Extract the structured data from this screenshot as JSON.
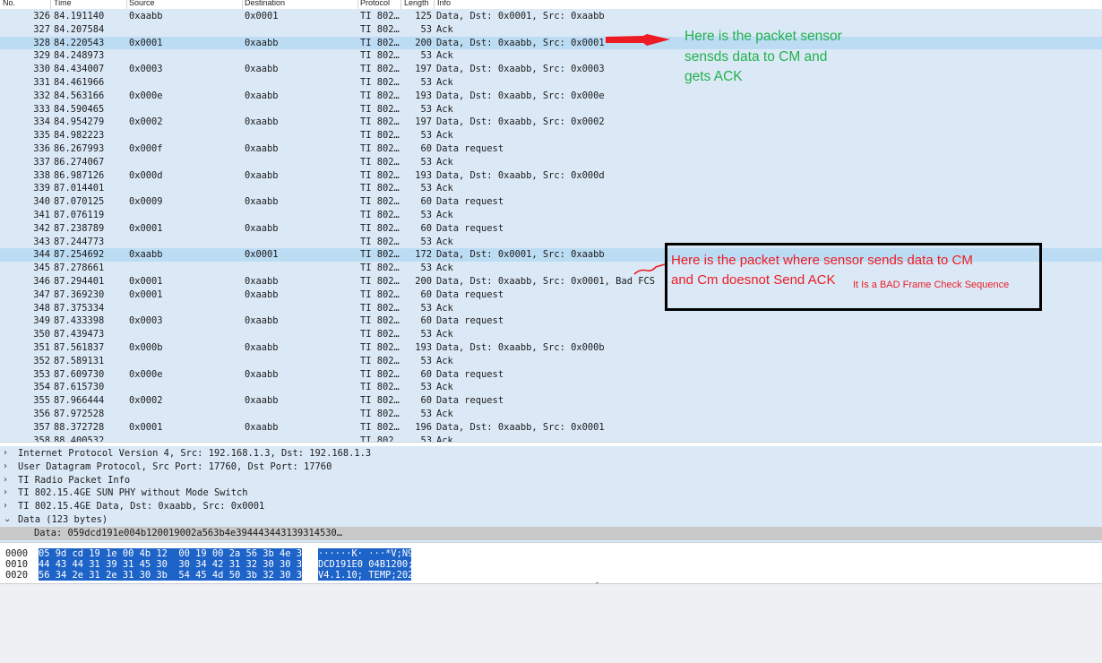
{
  "columns": {
    "no": "No.",
    "time": "Time",
    "source": "Source",
    "destination": "Destination",
    "protocol": "Protocol",
    "length": "Length",
    "info": "Info"
  },
  "packets": [
    {
      "no": "326",
      "time": "84.191140",
      "src": "0xaabb",
      "dst": "0x0001",
      "proto": "TI 802…",
      "len": "125",
      "info": "Data, Dst: 0x0001, Src: 0xaabb"
    },
    {
      "no": "327",
      "time": "84.207584",
      "src": "",
      "dst": "",
      "proto": "TI 802…",
      "len": "53",
      "info": "Ack"
    },
    {
      "no": "328",
      "time": "84.220543",
      "src": "0x0001",
      "dst": "0xaabb",
      "proto": "TI 802…",
      "len": "200",
      "info": "Data, Dst: 0xaabb, Src: 0x0001",
      "selected": true
    },
    {
      "no": "329",
      "time": "84.248973",
      "src": "",
      "dst": "",
      "proto": "TI 802…",
      "len": "53",
      "info": "Ack"
    },
    {
      "no": "330",
      "time": "84.434007",
      "src": "0x0003",
      "dst": "0xaabb",
      "proto": "TI 802…",
      "len": "197",
      "info": "Data, Dst: 0xaabb, Src: 0x0003"
    },
    {
      "no": "331",
      "time": "84.461966",
      "src": "",
      "dst": "",
      "proto": "TI 802…",
      "len": "53",
      "info": "Ack"
    },
    {
      "no": "332",
      "time": "84.563166",
      "src": "0x000e",
      "dst": "0xaabb",
      "proto": "TI 802…",
      "len": "193",
      "info": "Data, Dst: 0xaabb, Src: 0x000e"
    },
    {
      "no": "333",
      "time": "84.590465",
      "src": "",
      "dst": "",
      "proto": "TI 802…",
      "len": "53",
      "info": "Ack"
    },
    {
      "no": "334",
      "time": "84.954279",
      "src": "0x0002",
      "dst": "0xaabb",
      "proto": "TI 802…",
      "len": "197",
      "info": "Data, Dst: 0xaabb, Src: 0x0002"
    },
    {
      "no": "335",
      "time": "84.982223",
      "src": "",
      "dst": "",
      "proto": "TI 802…",
      "len": "53",
      "info": "Ack"
    },
    {
      "no": "336",
      "time": "86.267993",
      "src": "0x000f",
      "dst": "0xaabb",
      "proto": "TI 802…",
      "len": "60",
      "info": "Data request"
    },
    {
      "no": "337",
      "time": "86.274067",
      "src": "",
      "dst": "",
      "proto": "TI 802…",
      "len": "53",
      "info": "Ack"
    },
    {
      "no": "338",
      "time": "86.987126",
      "src": "0x000d",
      "dst": "0xaabb",
      "proto": "TI 802…",
      "len": "193",
      "info": "Data, Dst: 0xaabb, Src: 0x000d"
    },
    {
      "no": "339",
      "time": "87.014401",
      "src": "",
      "dst": "",
      "proto": "TI 802…",
      "len": "53",
      "info": "Ack"
    },
    {
      "no": "340",
      "time": "87.070125",
      "src": "0x0009",
      "dst": "0xaabb",
      "proto": "TI 802…",
      "len": "60",
      "info": "Data request"
    },
    {
      "no": "341",
      "time": "87.076119",
      "src": "",
      "dst": "",
      "proto": "TI 802…",
      "len": "53",
      "info": "Ack"
    },
    {
      "no": "342",
      "time": "87.238789",
      "src": "0x0001",
      "dst": "0xaabb",
      "proto": "TI 802…",
      "len": "60",
      "info": "Data request"
    },
    {
      "no": "343",
      "time": "87.244773",
      "src": "",
      "dst": "",
      "proto": "TI 802…",
      "len": "53",
      "info": "Ack"
    },
    {
      "no": "344",
      "time": "87.254692",
      "src": "0xaabb",
      "dst": "0x0001",
      "proto": "TI 802…",
      "len": "172",
      "info": "Data, Dst: 0x0001, Src: 0xaabb",
      "selected": true
    },
    {
      "no": "345",
      "time": "87.278661",
      "src": "",
      "dst": "",
      "proto": "TI 802…",
      "len": "53",
      "info": "Ack"
    },
    {
      "no": "346",
      "time": "87.294401",
      "src": "0x0001",
      "dst": "0xaabb",
      "proto": "TI 802…",
      "len": "200",
      "info": "Data, Dst: 0xaabb, Src: 0x0001, Bad FCS"
    },
    {
      "no": "347",
      "time": "87.369230",
      "src": "0x0001",
      "dst": "0xaabb",
      "proto": "TI 802…",
      "len": "60",
      "info": "Data request"
    },
    {
      "no": "348",
      "time": "87.375334",
      "src": "",
      "dst": "",
      "proto": "TI 802…",
      "len": "53",
      "info": "Ack"
    },
    {
      "no": "349",
      "time": "87.433398",
      "src": "0x0003",
      "dst": "0xaabb",
      "proto": "TI 802…",
      "len": "60",
      "info": "Data request"
    },
    {
      "no": "350",
      "time": "87.439473",
      "src": "",
      "dst": "",
      "proto": "TI 802…",
      "len": "53",
      "info": "Ack"
    },
    {
      "no": "351",
      "time": "87.561837",
      "src": "0x000b",
      "dst": "0xaabb",
      "proto": "TI 802…",
      "len": "193",
      "info": "Data, Dst: 0xaabb, Src: 0x000b"
    },
    {
      "no": "352",
      "time": "87.589131",
      "src": "",
      "dst": "",
      "proto": "TI 802…",
      "len": "53",
      "info": "Ack"
    },
    {
      "no": "353",
      "time": "87.609730",
      "src": "0x000e",
      "dst": "0xaabb",
      "proto": "TI 802…",
      "len": "60",
      "info": "Data request"
    },
    {
      "no": "354",
      "time": "87.615730",
      "src": "",
      "dst": "",
      "proto": "TI 802…",
      "len": "53",
      "info": "Ack"
    },
    {
      "no": "355",
      "time": "87.966444",
      "src": "0x0002",
      "dst": "0xaabb",
      "proto": "TI 802…",
      "len": "60",
      "info": "Data request"
    },
    {
      "no": "356",
      "time": "87.972528",
      "src": "",
      "dst": "",
      "proto": "TI 802…",
      "len": "53",
      "info": "Ack"
    },
    {
      "no": "357",
      "time": "88.372728",
      "src": "0x0001",
      "dst": "0xaabb",
      "proto": "TI 802…",
      "len": "196",
      "info": "Data, Dst: 0xaabb, Src: 0x0001"
    },
    {
      "no": "358",
      "time": "88.400532",
      "src": "",
      "dst": "",
      "proto": "TI 802…",
      "len": "53",
      "info": "Ack"
    }
  ],
  "details": [
    {
      "arrow": "›",
      "text": "Internet Protocol Version 4, Src: 192.168.1.3, Dst: 192.168.1.3"
    },
    {
      "arrow": "›",
      "text": "User Datagram Protocol, Src Port: 17760, Dst Port: 17760"
    },
    {
      "arrow": "›",
      "text": "TI Radio Packet Info"
    },
    {
      "arrow": "›",
      "text": "TI 802.15.4GE SUN PHY without Mode Switch"
    },
    {
      "arrow": "›",
      "text": "TI 802.15.4GE Data, Dst: 0xaabb, Src: 0x0001"
    },
    {
      "arrow": "⌄",
      "text": "Data (123 bytes)"
    },
    {
      "arrow": "",
      "text": "Data: 059dcd191e004b120019002a563b4e394443443139314530…",
      "child": true
    }
  ],
  "hex": [
    {
      "offset": "0000",
      "bytes": "05 9d cd 19 1e 00 4b 12  00 19 00 2a 56 3b 4e 39",
      "ascii": "······K· ···*V;N9"
    },
    {
      "offset": "0010",
      "bytes": "44 43 44 31 39 31 45 30  30 34 42 31 32 30 30 3b",
      "ascii": "DCD191E0 04B1200;"
    },
    {
      "offset": "0020",
      "bytes": "56 34 2e 31 2e 31 30 3b  54 45 4d 50 3b 32 30 32",
      "ascii": "V4.1.10; TEMP;202"
    }
  ],
  "annotations": {
    "green_note": [
      "Here is the packet sensor",
      "sensds data to CM and",
      "gets ACK"
    ],
    "red_note": [
      "Here is the packet where sensor sends data to CM",
      "and Cm doesnot Send ACK"
    ],
    "red_note_small": "It Is a BAD Frame Check Sequence",
    "colors": {
      "green": "#22b14c",
      "red": "#ed1c24",
      "selection": "#bcdcf4",
      "list_bg": "#dbe9f7",
      "hex_highlight": "#1e63c7"
    }
  }
}
